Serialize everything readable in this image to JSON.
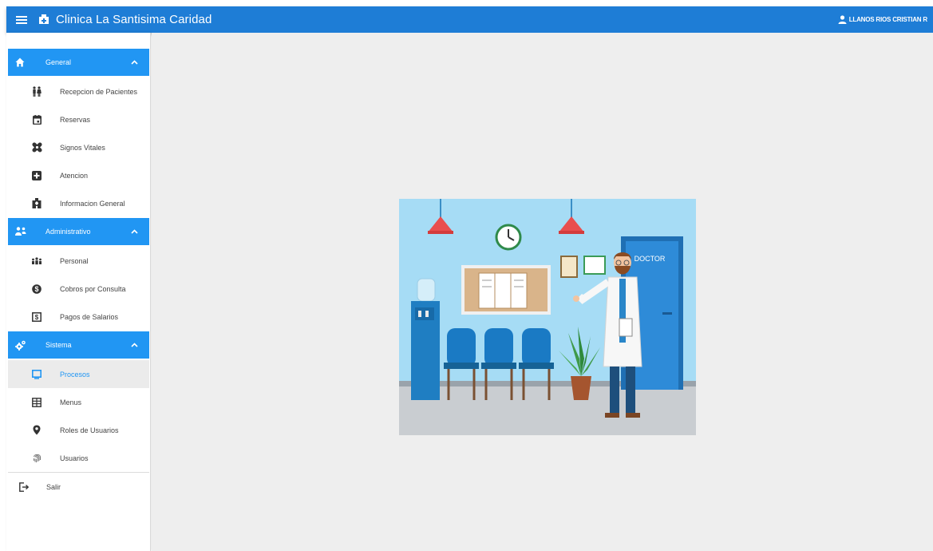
{
  "header": {
    "title": "Clinica La Santisima Caridad",
    "user": "LLANOS RIOS CRISTIAN R",
    "menu_icon": "hamburger-icon",
    "logo_icon": "clinic-icon"
  },
  "sidebar": {
    "sections": [
      {
        "label": "General",
        "icon": "home-icon",
        "items": [
          {
            "label": "Recepcion de Pacientes",
            "icon": "people-icon"
          },
          {
            "label": "Reservas",
            "icon": "calendar-icon"
          },
          {
            "label": "Signos Vitales",
            "icon": "bandage-icon"
          },
          {
            "label": "Atencion",
            "icon": "medical-cross-icon"
          },
          {
            "label": "Informacion General",
            "icon": "building-icon"
          }
        ]
      },
      {
        "label": "Administrativo",
        "icon": "admin-icon",
        "items": [
          {
            "label": "Personal",
            "icon": "staff-icon"
          },
          {
            "label": "Cobros por Consulta",
            "icon": "coin-icon"
          },
          {
            "label": "Pagos de Salarios",
            "icon": "money-icon"
          }
        ]
      },
      {
        "label": "Sistema",
        "icon": "gears-icon",
        "items": [
          {
            "label": "Procesos",
            "icon": "monitor-icon"
          },
          {
            "label": "Menus",
            "icon": "menu-grid-icon"
          },
          {
            "label": "Roles de Usuarios",
            "icon": "role-pin-icon"
          },
          {
            "label": "Usuarios",
            "icon": "fingerprint-icon"
          }
        ]
      }
    ],
    "active_item": "Procesos",
    "logout": {
      "label": "Salir",
      "icon": "logout-icon"
    }
  },
  "illustration": {
    "door_sign": "DOCTOR"
  },
  "colors": {
    "primary": "#1e7dd6",
    "section": "#2196f3",
    "background": "#eeeeee"
  }
}
